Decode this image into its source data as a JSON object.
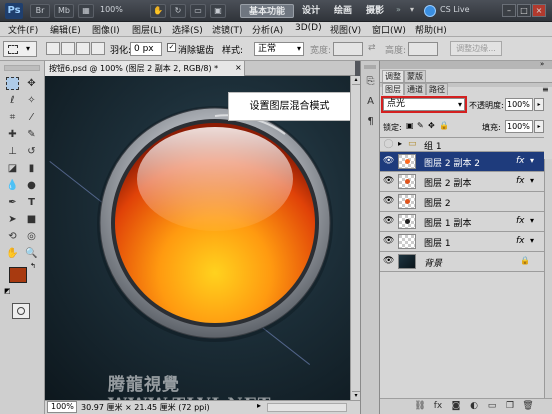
{
  "titlebar": {
    "logo": "Ps",
    "zoom": "100%",
    "workspaces": [
      "基本功能",
      "设计",
      "绘画",
      "摄影"
    ],
    "active_workspace": "基本功能",
    "cs_live": "CS Live"
  },
  "menu": [
    "文件(F)",
    "编辑(E)",
    "图像(I)",
    "图层(L)",
    "选择(S)",
    "滤镜(T)",
    "分析(A)",
    "3D(D)",
    "视图(V)",
    "窗口(W)",
    "帮助(H)"
  ],
  "options": {
    "feather_label": "羽化:",
    "feather_value": "0 px",
    "antialias_label": "消除锯齿",
    "style_label": "样式:",
    "style_value": "正常",
    "width_label": "宽度:",
    "height_label": "高度:",
    "refine_edge": "调整边缘..."
  },
  "document": {
    "tab_title": "按钮6.psd @ 100% (图层 2 副本 2, RGB/8) *",
    "zoom": "100%",
    "size_info": "30.97 厘米 × 21.45 厘米 (72 ppi)"
  },
  "callout": "设置图层混合模式",
  "watermark": "腾龍視覺 WWW.TLVI.NET",
  "panel": {
    "tabs_top": [
      "调整",
      "蒙版"
    ],
    "tabs_layers": [
      "图层",
      "通道",
      "路径"
    ],
    "blend_mode": "点光",
    "opacity_label": "不透明度:",
    "opacity_value": "100%",
    "lock_label": "锁定:",
    "fill_label": "填充:",
    "fill_value": "100%",
    "layers": [
      {
        "name": "组 1",
        "type": "group",
        "fx": "",
        "selected": false
      },
      {
        "name": "图层 2 副本 2",
        "type": "layer",
        "fx": "fx",
        "selected": true
      },
      {
        "name": "图层 2 副本",
        "type": "layer",
        "fx": "fx",
        "selected": false
      },
      {
        "name": "图层 2",
        "type": "layer",
        "fx": "",
        "selected": false
      },
      {
        "name": "图层 1 副本",
        "type": "layer",
        "fx": "fx",
        "selected": false
      },
      {
        "name": "图层 1",
        "type": "layer",
        "fx": "fx",
        "selected": false
      },
      {
        "name": "背景",
        "type": "background",
        "fx": "",
        "selected": false
      }
    ]
  },
  "colors": {
    "foreground": "#a83a10",
    "background": "#ffffff",
    "selection": "#1e3b7c",
    "callout_border": "#d42020"
  }
}
